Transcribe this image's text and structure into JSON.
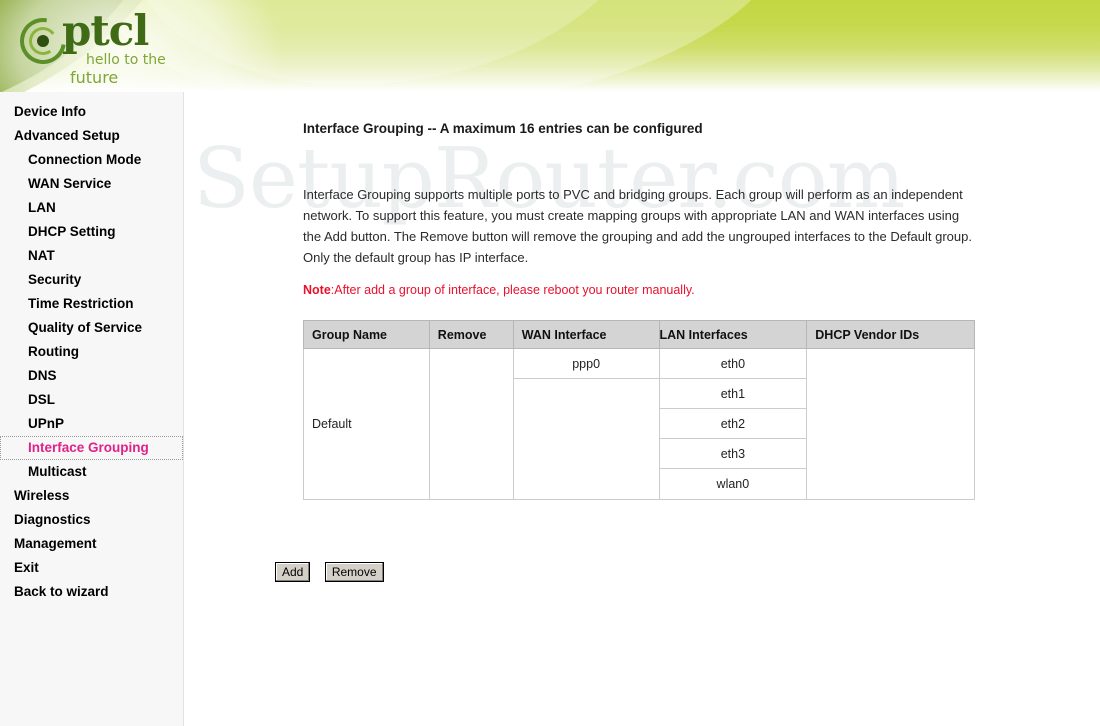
{
  "brand": {
    "logo_word": "ptcl",
    "tagline_line1": "hello to the",
    "tagline_line2": "future"
  },
  "watermark": {
    "text": "SetupRouter.com"
  },
  "sidebar": {
    "items": [
      {
        "label": "Device Info",
        "level": 1,
        "active": false
      },
      {
        "label": "Advanced Setup",
        "level": 1,
        "active": false
      },
      {
        "label": "Connection Mode",
        "level": 2,
        "active": false
      },
      {
        "label": "WAN Service",
        "level": 2,
        "active": false
      },
      {
        "label": "LAN",
        "level": 2,
        "active": false
      },
      {
        "label": "DHCP Setting",
        "level": 2,
        "active": false
      },
      {
        "label": "NAT",
        "level": 2,
        "active": false
      },
      {
        "label": "Security",
        "level": 2,
        "active": false
      },
      {
        "label": "Time Restriction",
        "level": 2,
        "active": false
      },
      {
        "label": "Quality of Service",
        "level": 2,
        "active": false
      },
      {
        "label": "Routing",
        "level": 2,
        "active": false
      },
      {
        "label": "DNS",
        "level": 2,
        "active": false
      },
      {
        "label": "DSL",
        "level": 2,
        "active": false
      },
      {
        "label": "UPnP",
        "level": 2,
        "active": false
      },
      {
        "label": "Interface Grouping",
        "level": 2,
        "active": true
      },
      {
        "label": "Multicast",
        "level": 2,
        "active": false
      },
      {
        "label": "Wireless",
        "level": 1,
        "active": false
      },
      {
        "label": "Diagnostics",
        "level": 1,
        "active": false
      },
      {
        "label": "Management",
        "level": 1,
        "active": false
      },
      {
        "label": "Exit",
        "level": 1,
        "active": false
      },
      {
        "label": "Back to wizard",
        "level": 1,
        "active": false
      }
    ],
    "active_color": "#e0218a"
  },
  "main": {
    "title": "Interface Grouping -- A maximum 16 entries can be configured",
    "description": "Interface Grouping supports multiple ports to PVC and bridging groups. Each group will perform as an independent network. To support this feature, you must create mapping groups with appropriate LAN and WAN interfaces using the Add button. The Remove button will remove the grouping and add the ungrouped interfaces to the Default group. Only the default group has IP interface.",
    "note_label": "Note",
    "note_text": ":After add a group of interface, please reboot you router manually.",
    "note_color": "#e8112d"
  },
  "table": {
    "headers": [
      "Group Name",
      "Remove",
      "WAN Interface",
      "LAN Interfaces",
      "DHCP Vendor IDs"
    ],
    "rows": [
      {
        "group_name": "Default",
        "remove": "",
        "wan_interface": "ppp0",
        "lan_interfaces": [
          "eth0",
          "eth1",
          "eth2",
          "eth3",
          "wlan0"
        ],
        "dhcp_vendor_ids": ""
      }
    ]
  },
  "buttons": {
    "add": "Add",
    "remove": "Remove"
  }
}
